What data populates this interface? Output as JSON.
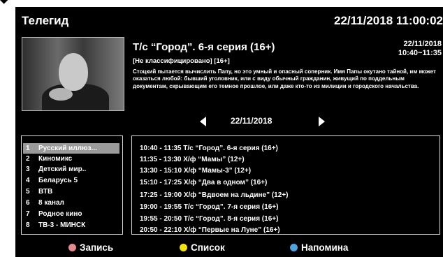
{
  "header": {
    "title": "Телегид",
    "clock": "22/11/2018 11:00:02"
  },
  "program": {
    "title": "Т/с “Город”. 6-я серия (16+)",
    "rating": "[Не классифицировано] [16+]",
    "date": "22/11/2018",
    "time": "10:40~11:35",
    "description": "Стоцкий пытается вычислить Папу, но это умный и опасный соперник. Имя Папы окутано тайной, им может оказаться любой: бывший уголовник, или с виду обычный гражданин, живущий по поддельным документам, скрывающим его темное прошлое, или даже кто-то из милиции и городского начальства."
  },
  "date_nav": {
    "date": "22/11/2018"
  },
  "channels": [
    {
      "num": "1",
      "name": "Русский иллюз...",
      "selected": true
    },
    {
      "num": "2",
      "name": "Киномикс"
    },
    {
      "num": "3",
      "name": "Детский мир.."
    },
    {
      "num": "4",
      "name": "Беларусь 5"
    },
    {
      "num": "5",
      "name": "ВТВ"
    },
    {
      "num": "6",
      "name": "8 канал"
    },
    {
      "num": "7",
      "name": "Родное кино"
    },
    {
      "num": "8",
      "name": "ТВ-3 - МИНСК"
    }
  ],
  "schedule": [
    "10:40 - 11:35 Т/с “Город”. 6-я серия (16+)",
    "11:35 - 13:30 Х/ф “Мамы” (12+)",
    "13:30 - 15:10 Х/ф “Мамы-3” (12+)",
    "15:10 - 17:25 Х/ф “Два в одном” (16+)",
    "17:25 - 19:00 Х/ф “Вдвоем на льдине” (12+)",
    "19:00 - 19:55 Т/с “Город”. 7-я серия (16+)",
    "19:55 - 20:50 Т/с “Город”. 8-я серия (16+)",
    "20:50 - 22:10 Х/ф “Первые на Луне” (16+)"
  ],
  "legend": {
    "record": {
      "label": "Запись",
      "color": "#e88a8e"
    },
    "list": {
      "label": "Список",
      "color": "#f2e600"
    },
    "reminder": {
      "label": "Напомина",
      "color": "#4ca3e0"
    }
  }
}
